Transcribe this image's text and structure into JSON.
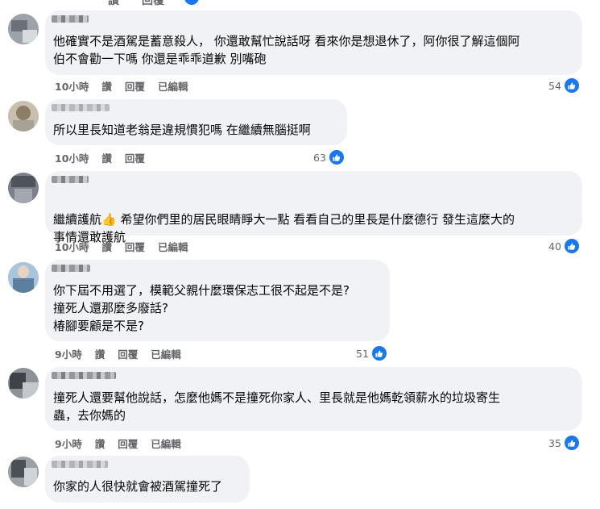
{
  "top": {
    "action_like": "讚",
    "action_reply": "回覆"
  },
  "comments": [
    {
      "text": "他確實不是酒駕是蓄意殺人， 你還敢幫忙說話呀 看來你是想退休了，阿你很了解這個阿\n伯不會勸一下嗎 你還是乖乖道歉 別嘴砲",
      "time": "10小時",
      "like": "讚",
      "reply": "回覆",
      "edited": "已編輯",
      "likes": "54"
    },
    {
      "text": "所以里長知道老翁是違規慣犯嗎 在繼續無腦挺啊",
      "time": "10小時",
      "like": "讚",
      "reply": "回覆",
      "likes": "63"
    },
    {
      "text_before": "繼續護航",
      "emoji": "👍",
      "text_after": " 希望你們里的居民眼睛睜大一點 看看自己的里長是什麼德行 發生這麼大的",
      "text_line2": "事情還敢護航",
      "time": "10小時",
      "like": "讚",
      "reply": "回覆",
      "edited": "已編輯",
      "likes": "40"
    },
    {
      "text": "你下屆不用選了，模範父親什麼環保志工很不起是不是?\n撞死人還那麼多廢話?\n椿腳要顧是不是?",
      "time": "9小時",
      "like": "讚",
      "reply": "回覆",
      "edited": "已編輯",
      "likes": "51"
    },
    {
      "text": "撞死人還要幫他說話，怎麼他媽不是撞死你家人、里長就是他媽乾領薪水的垃圾寄生\n蟲，去你媽的",
      "time": "9小時",
      "like": "讚",
      "reply": "回覆",
      "edited": "已編輯",
      "likes": "35"
    },
    {
      "text": "你家的人很快就會被酒駕撞死了"
    }
  ],
  "colors": {
    "bubble": "#f0f2f5",
    "meta": "#65676b",
    "like_blue": "#1877f2"
  },
  "icons": {
    "like": "thumbs-up-icon"
  }
}
